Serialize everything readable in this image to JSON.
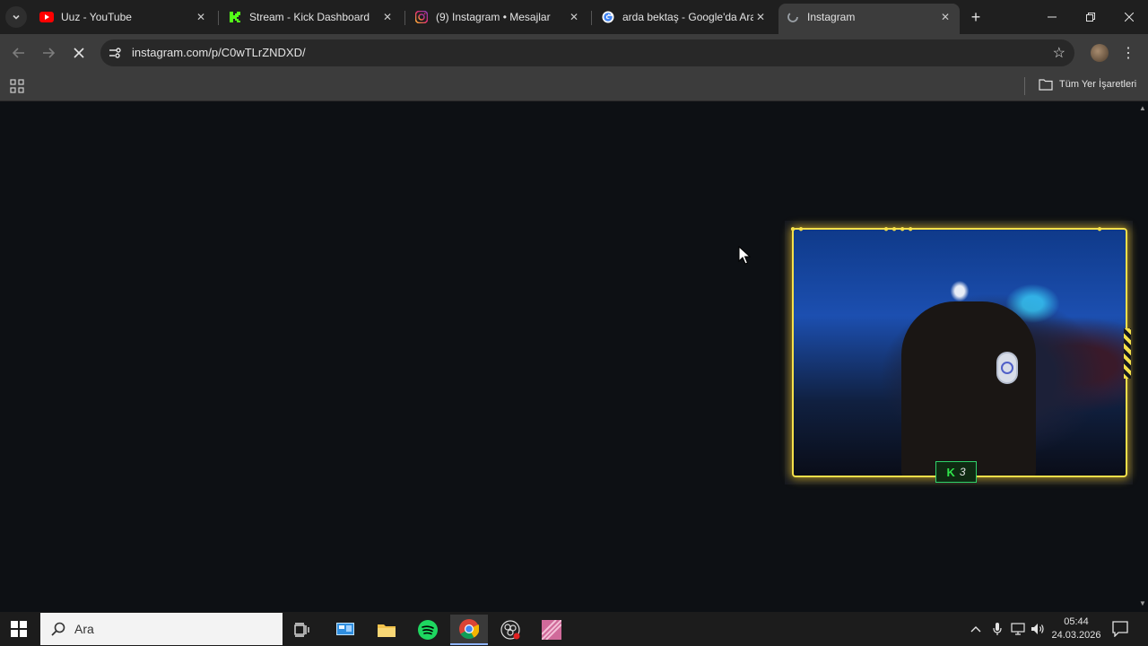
{
  "browser": {
    "tabs": [
      {
        "title": "Uuz - YouTube",
        "icon": "youtube-icon",
        "active": false
      },
      {
        "title": "Stream - Kick Dashboard",
        "icon": "kick-icon",
        "active": false
      },
      {
        "title": "(9) Instagram • Mesajlar",
        "icon": "instagram-icon",
        "active": false
      },
      {
        "title": "arda bektaş - Google'da Ara",
        "icon": "google-icon",
        "active": false
      },
      {
        "title": "Instagram",
        "icon": "loading-icon",
        "active": true
      }
    ],
    "url": "instagram.com/p/C0wTLrZNDXD/",
    "bookmarks": {
      "all_label": "Tüm Yer İşaretleri"
    }
  },
  "webcam": {
    "badge_count": "3"
  },
  "taskbar": {
    "search_placeholder": "Ara",
    "time": "05:44",
    "date": "24.03.2026",
    "apps": [
      "task-view",
      "control-panel",
      "file-explorer",
      "spotify",
      "chrome",
      "obs",
      "media-app"
    ]
  },
  "colors": {
    "tab_bg": "#1f1f1f",
    "toolbar_bg": "#3c3c3c",
    "page_bg": "#0d1014",
    "cam_accent": "#f5e04a",
    "kick_green": "#2fe44a"
  }
}
